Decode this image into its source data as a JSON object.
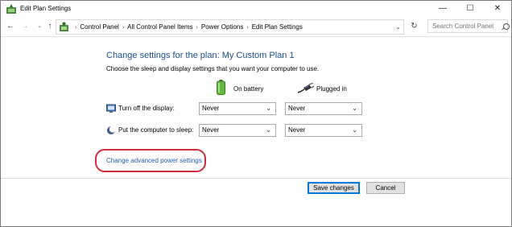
{
  "window": {
    "title": "Edit Plan Settings",
    "controls": {
      "minimize": "—",
      "maximize": "☐",
      "close": "✕"
    }
  },
  "nav": {
    "back": "←",
    "forward": "→",
    "history": "⌄",
    "up": "↑",
    "breadcrumbs": [
      "Control Panel",
      "All Control Panel Items",
      "Power Options",
      "Edit Plan Settings"
    ],
    "separator": "›",
    "dropdown": "⌄",
    "refresh": "↻",
    "search_placeholder": "Search Control Panel"
  },
  "page": {
    "title": "Change settings for the plan: My Custom Plan 1",
    "subtitle": "Choose the sleep and display settings that you want your computer to use.",
    "columns": {
      "battery": "On battery",
      "plugged": "Plugged in"
    },
    "rows": [
      {
        "label": "Turn off the display:",
        "battery": "Never",
        "plugged": "Never"
      },
      {
        "label": "Put the computer to sleep:",
        "battery": "Never",
        "plugged": "Never"
      }
    ],
    "dropdown_arrow": "⌄",
    "advanced_link": "Change advanced power settings"
  },
  "buttons": {
    "save": "Save changes",
    "cancel": "Cancel"
  },
  "colors": {
    "title_blue": "#1e4e8c",
    "link_blue": "#1e5fb4",
    "highlight_red": "#d42a3a",
    "button_focus": "#0078d7"
  }
}
